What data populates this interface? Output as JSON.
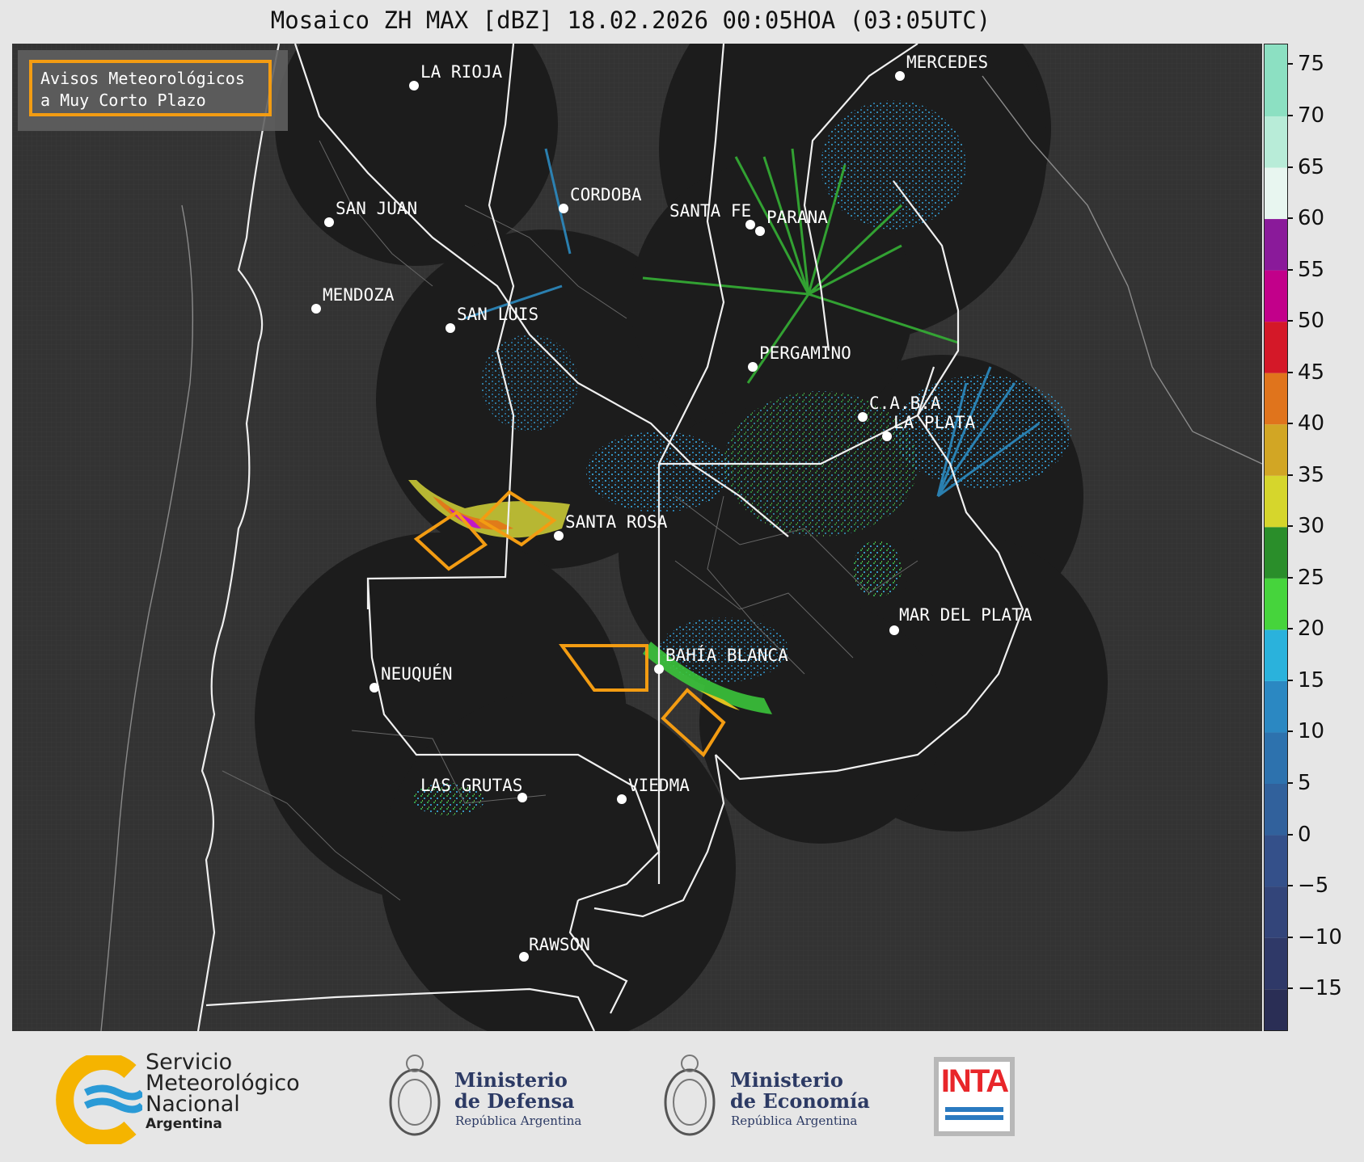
{
  "title": "Mosaico ZH MAX [dBZ] 18.02.2026 00:05HOA (03:05UTC)",
  "legend": {
    "line1": "Avisos Meteorológicos",
    "line2": "a Muy Corto Plazo",
    "warning_color": "#f39c12"
  },
  "cities": [
    {
      "name": "LA RIOJA",
      "id": "la-rioja"
    },
    {
      "name": "MERCEDES",
      "id": "mercedes"
    },
    {
      "name": "CORDOBA",
      "id": "cordoba"
    },
    {
      "name": "SAN JUAN",
      "id": "san-juan"
    },
    {
      "name": "SANTA FE",
      "id": "santa-fe"
    },
    {
      "name": "PARANA",
      "id": "parana"
    },
    {
      "name": "MENDOZA",
      "id": "mendoza"
    },
    {
      "name": "SAN LUIS",
      "id": "san-luis"
    },
    {
      "name": "PERGAMINO",
      "id": "pergamino"
    },
    {
      "name": "C.A.B.A",
      "id": "caba"
    },
    {
      "name": "LA PLATA",
      "id": "la-plata"
    },
    {
      "name": "SANTA ROSA",
      "id": "santa-rosa"
    },
    {
      "name": "MAR DEL PLATA",
      "id": "mar-del-plata"
    },
    {
      "name": "BAHÍA BLANCA",
      "id": "bahia-blanca"
    },
    {
      "name": "NEUQUÉN",
      "id": "neuquen"
    },
    {
      "name": "LAS GRUTAS",
      "id": "las-grutas"
    },
    {
      "name": "VIEDMA",
      "id": "viedma"
    },
    {
      "name": "RAWSON",
      "id": "rawson"
    }
  ],
  "colorbar": {
    "ticks": [
      "75",
      "70",
      "65",
      "60",
      "55",
      "50",
      "45",
      "40",
      "35",
      "30",
      "25",
      "20",
      "15",
      "10",
      "5",
      "0",
      "−5",
      "−10",
      "−15"
    ],
    "min": -19,
    "max": 77
  },
  "footer": {
    "smn": {
      "line1": "Servicio",
      "line2": "Meteorológico",
      "line3": "Nacional",
      "line4": "Argentina"
    },
    "defensa": {
      "line1": "Ministerio",
      "line2": "de Defensa",
      "sub": "República Argentina"
    },
    "economia": {
      "line1": "Ministerio",
      "line2": "de Economía",
      "sub": "República Argentina"
    },
    "inta": {
      "text": "INTA",
      "color": "#e8262a"
    }
  }
}
